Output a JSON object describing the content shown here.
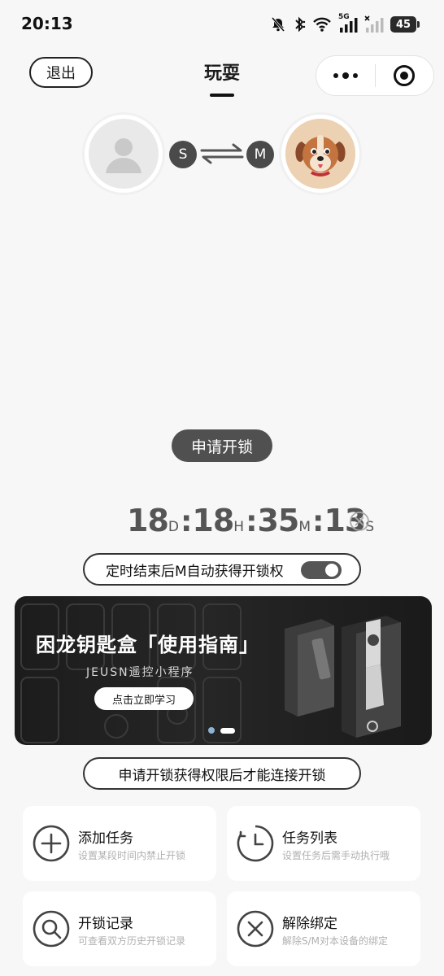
{
  "status_bar": {
    "time": "20:13",
    "icons": [
      "bell-muted-icon",
      "bluetooth-icon",
      "wifi-icon",
      "signal-5g-icon",
      "signal-x-icon",
      "battery-icon"
    ],
    "network_label": "5G",
    "battery_level": "45"
  },
  "header": {
    "exit_label": "退出",
    "title": "玩耍",
    "capsule_icons": [
      "more-dots-icon",
      "target-close-icon"
    ]
  },
  "pairing": {
    "left_badge": "S",
    "right_badge": "M",
    "left_avatar_icon": "default-user-icon",
    "right_avatar_icon": "dog-avatar-icon",
    "swap_icon": "swap-arrows-icon"
  },
  "request_unlock_label": "申请开锁",
  "countdown": {
    "days": "18",
    "days_unit": "D",
    "hours": "18",
    "hours_unit": "H",
    "minutes": "35",
    "minutes_unit": "M",
    "seconds": "13",
    "seconds_unit": "S",
    "separator": ":",
    "cancel_icon": "circle-x-icon"
  },
  "auto_unlock": {
    "label": "定时结束后M自动获得开锁权",
    "toggle_on": true
  },
  "banner": {
    "title": "困龙钥匙盒「使用指南」",
    "subtitle": "JEUSN遥控小程序",
    "button_label": "点击立即学习",
    "slide_count": 2,
    "active_slide": 2
  },
  "permission_notice": "申请开锁获得权限后才能连接开锁",
  "cards": [
    {
      "title": "添加任务",
      "desc": "设置某段时间内禁止开锁",
      "icon": "plus-circle-icon"
    },
    {
      "title": "任务列表",
      "desc": "设置任务后需手动执行哦",
      "icon": "clock-icon"
    },
    {
      "title": "开锁记录",
      "desc": "可查看双方历史开锁记录",
      "icon": "search-icon"
    },
    {
      "title": "解除绑定",
      "desc": "解除S/M对本设备的绑定",
      "icon": "close-circle-icon"
    }
  ],
  "colors": {
    "background": "#f7f7f7",
    "dark_pill": "#505050",
    "badge": "#4a4a4a",
    "banner_dot": "#8ab4d8"
  }
}
